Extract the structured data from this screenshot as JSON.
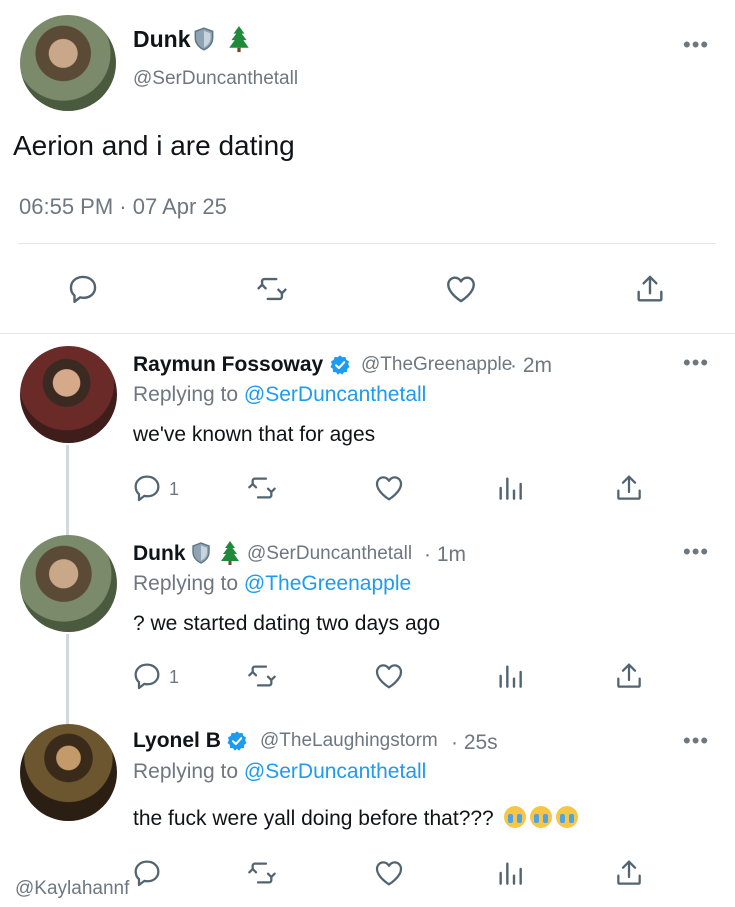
{
  "main_tweet": {
    "name": "Dunk",
    "handle": "@SerDuncanthetall",
    "text": "Aerion and i are dating",
    "timestamp": "06:55 PM · 07 Apr 25",
    "badges": [
      "shield-icon",
      "tree-icon"
    ]
  },
  "replies": [
    {
      "name": "Raymun Fossoway",
      "verified": true,
      "handle": "@TheGreenapple",
      "time": "· 2m",
      "replying_prefix": "Replying to",
      "replying_to": "@SerDuncanthetall",
      "text": "we've known that for ages",
      "reply_count": "1"
    },
    {
      "name": "Dunk",
      "handle": "@SerDuncanthetall",
      "time": "· 1m",
      "replying_prefix": "Replying to",
      "replying_to": "@TheGreenapple",
      "text": "? we started dating two days ago",
      "reply_count": "1"
    },
    {
      "name": "Lyonel B",
      "verified": true,
      "handle": "@TheLaughingstorm",
      "time": "· 25s",
      "replying_prefix": "Replying to",
      "replying_to": "@SerDuncanthetall",
      "text": "the fuck were yall doing before that???",
      "emojis": [
        "crying-face-emoji",
        "crying-face-emoji",
        "crying-face-emoji"
      ]
    }
  ],
  "watermark": "@Kaylahannf",
  "colors": {
    "accent": "#1d9bf0",
    "muted": "#6e7780",
    "divider": "#e3e6e9"
  }
}
